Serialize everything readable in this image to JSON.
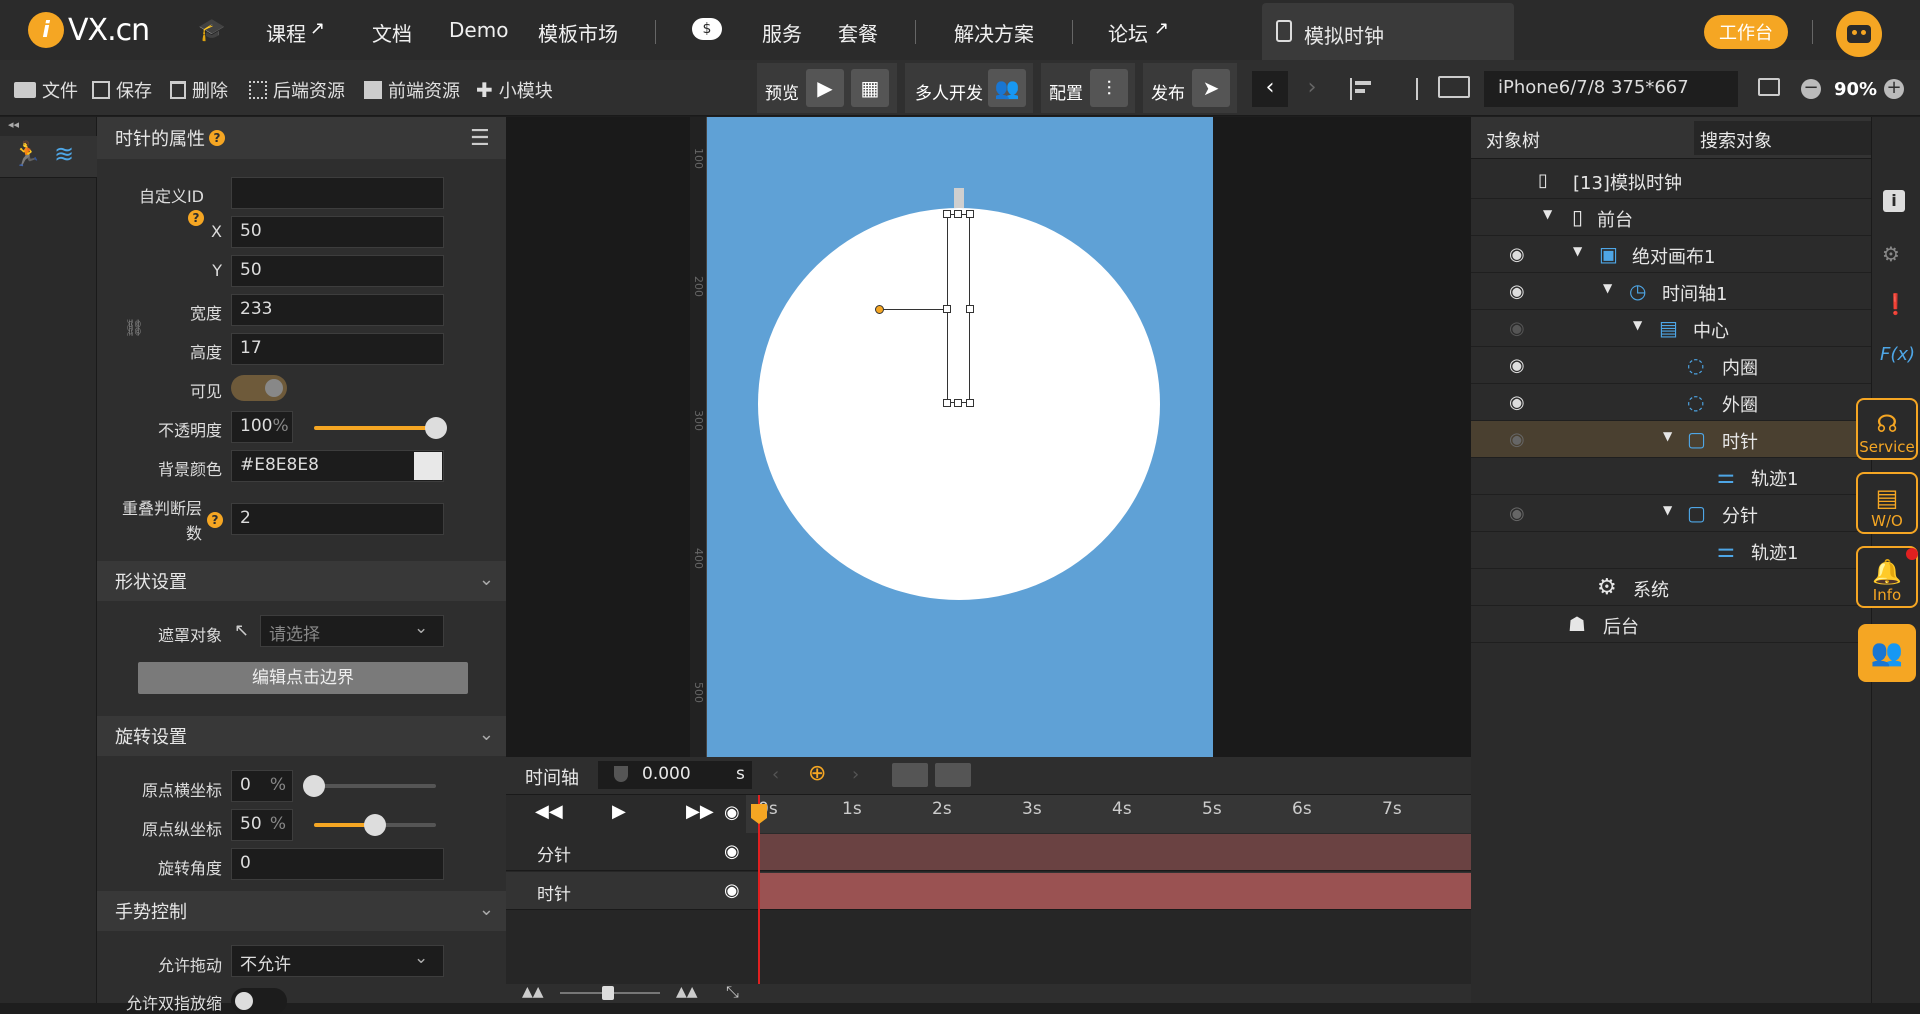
{
  "nav": {
    "logo_text": "VX.cn",
    "items": [
      "课程",
      "文档",
      "Demo",
      "模板市场",
      "服务",
      "套餐",
      "解决方案",
      "论坛"
    ],
    "active_tab": "模拟时钟",
    "workbench": "工作台"
  },
  "toolbar": {
    "file": "文件",
    "save": "保存",
    "delete": "删除",
    "backend_res": "后端资源",
    "frontend_res": "前端资源",
    "module": "小模块",
    "preview": "预览",
    "multi_dev": "多人开发",
    "config": "配置",
    "publish": "发布",
    "device": "iPhone6/7/8 375*667",
    "zoom": "90%"
  },
  "props": {
    "title": "时针的属性",
    "custom_id_label": "自定义ID",
    "custom_id_value": "",
    "x_label": "X",
    "x_value": "50",
    "y_label": "Y",
    "y_value": "50",
    "width_label": "宽度",
    "width_value": "233",
    "height_label": "高度",
    "height_value": "17",
    "visible_label": "可见",
    "opacity_label": "不透明度",
    "opacity_value": "100",
    "opacity_unit": "%",
    "bg_label": "背景颜色",
    "bg_value": "#E8E8E8",
    "overlap_label_1": "重叠判断层",
    "overlap_label_2": "数",
    "overlap_value": "2"
  },
  "shape": {
    "title": "形状设置",
    "mask_label": "遮罩对象",
    "mask_placeholder": "请选择",
    "edit_btn": "编辑点击边界"
  },
  "rotate": {
    "title": "旋转设置",
    "ox_label": "原点横坐标",
    "ox_value": "0",
    "oy_label": "原点纵坐标",
    "oy_value": "50",
    "unit": "%",
    "angle_label": "旋转角度",
    "angle_value": "0"
  },
  "gesture": {
    "title": "手势控制",
    "drag_label": "允许拖动",
    "drag_value": "不允许",
    "pinch_label": "允许双指放缩"
  },
  "ruler": [
    "100",
    "200",
    "300",
    "400",
    "500"
  ],
  "timeline": {
    "label": "时间轴",
    "time": "0.000",
    "unit": "s",
    "ticks": [
      "0s",
      "1s",
      "2s",
      "3s",
      "4s",
      "5s",
      "6s",
      "7s"
    ],
    "tracks": [
      "分针",
      "时针"
    ]
  },
  "tree": {
    "tab_objects": "对象树",
    "tab_search": "搜索对象",
    "nodes": [
      "[13]模拟时钟",
      "前台",
      "绝对画布1",
      "时间轴1",
      "中心",
      "内圈",
      "外圈",
      "时针",
      "轨迹1",
      "分针",
      "轨迹1",
      "系统",
      "后台"
    ]
  },
  "side": {
    "service": "Service",
    "wo": "W/O",
    "info": "Info"
  },
  "colors": {
    "accent": "#F5A623",
    "canvas_bg": "#5FA1D6",
    "track": "#9A5252",
    "selected_row": "#4A4030"
  }
}
